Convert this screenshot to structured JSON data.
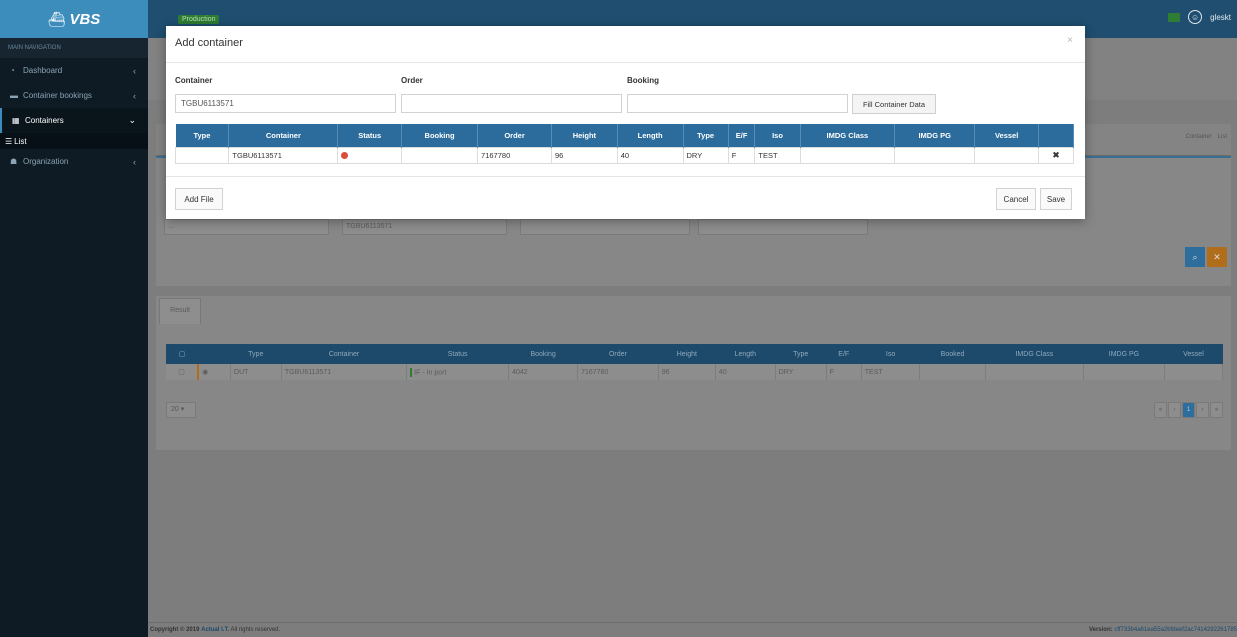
{
  "app": {
    "brand": "VBS",
    "environment": "Production",
    "user": "gleskt"
  },
  "sidebar": {
    "header": "MAIN NAVIGATION",
    "items": [
      {
        "label": "Dashboard",
        "icon": "dashboard-icon"
      },
      {
        "label": "Container bookings",
        "icon": "folder-icon"
      },
      {
        "label": "Containers",
        "icon": "grid-icon"
      },
      {
        "label": "Organization",
        "icon": "users-icon"
      }
    ],
    "sub_items": [
      {
        "label": "List",
        "icon": "list-icon"
      }
    ]
  },
  "view_toggle": {
    "container": "Container",
    "list": "List"
  },
  "filter": {
    "container_value": "TGBU6113571"
  },
  "result": {
    "tab_label": "Result",
    "columns": [
      "Type",
      "Container",
      "Status",
      "Booking",
      "Order",
      "Height",
      "Length",
      "Type",
      "E/F",
      "Iso",
      "Booked",
      "IMDG Class",
      "IMDG PG",
      "Vessel"
    ],
    "rows": [
      {
        "type": "OUT",
        "container": "TGBU6113571",
        "status": "IF - In port",
        "booking": "4042",
        "order": "7167780",
        "height": "96",
        "length": "40",
        "type2": "DRY",
        "ef": "F",
        "iso": "TEST",
        "booked": "",
        "imdg_class": "",
        "imdg_pg": "",
        "vessel": ""
      }
    ],
    "page_size": "20",
    "pager": {
      "first": "«",
      "prev": "‹",
      "current": "1",
      "next": "›",
      "last": "»"
    }
  },
  "modal": {
    "title": "Add container",
    "close": "×",
    "labels": {
      "container": "Container",
      "order": "Order",
      "booking": "Booking"
    },
    "values": {
      "container": "TGBU6113571",
      "order": "",
      "booking": ""
    },
    "fill_button": "Fill Container Data",
    "table": {
      "columns": [
        "Type",
        "Container",
        "Status",
        "Booking",
        "Order",
        "Height",
        "Length",
        "Type",
        "E/F",
        "Iso",
        "IMDG Class",
        "IMDG PG",
        "Vessel",
        ""
      ],
      "rows": [
        {
          "type": "",
          "container": "TGBU6113571",
          "status_color": "#dd4b39",
          "booking": "",
          "order": "7167780",
          "height": "96",
          "length": "40",
          "type2": "DRY",
          "ef": "F",
          "iso": "TEST",
          "imdg_class": "",
          "imdg_pg": "",
          "vessel": "",
          "remove": "✖"
        }
      ]
    },
    "add_file": "Add File",
    "cancel": "Cancel",
    "save": "Save"
  },
  "footer": {
    "copyright_prefix": "Copyright © 2019",
    "company": "Actual I.T.",
    "copyright_suffix": "All rights reserved.",
    "version_label": "Version:",
    "version_hash": "cff733b4a61ea55a2bfdeef2ac7414292261785"
  }
}
